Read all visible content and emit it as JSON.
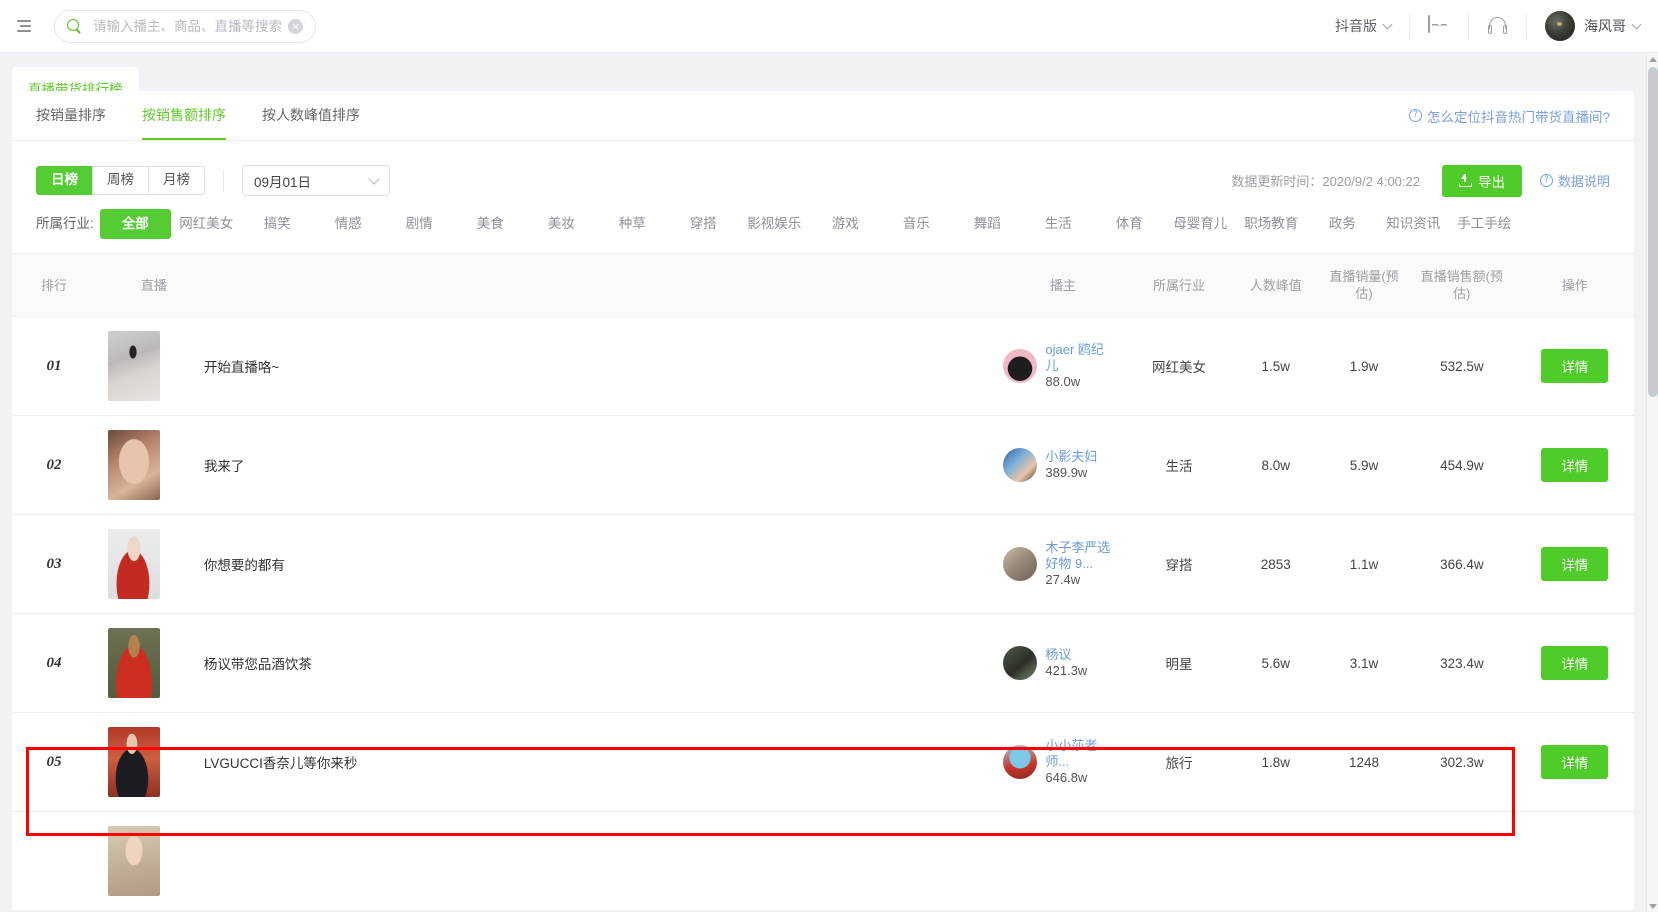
{
  "header": {
    "collapse_icon": "menu-collapse-icon",
    "search": {
      "placeholder": "请输入播主、商品、直播等搜索",
      "value": "",
      "icon": "search-icon",
      "clear": "×"
    },
    "version_label": "抖音版",
    "monitor_icon": "monitor-chart-icon",
    "service_icon": "headset-icon",
    "username": "海风哥"
  },
  "page_tab": {
    "label": "直播带货排行榜"
  },
  "sort_tabs": [
    {
      "label": "按销量排序",
      "active": false
    },
    {
      "label": "按销售额排序",
      "active": true
    },
    {
      "label": "按人数峰值排序",
      "active": false
    }
  ],
  "help_link": {
    "icon": "question-circle-icon",
    "label": "怎么定位抖音热门带货直播间?"
  },
  "period": {
    "options": [
      {
        "label": "日榜",
        "active": true
      },
      {
        "label": "周榜",
        "active": false
      },
      {
        "label": "月榜",
        "active": false
      }
    ],
    "date_value": "09月01日",
    "date_chevron": "chevron-down-icon"
  },
  "toolbar": {
    "update_time": "数据更新时间：2020/9/2 4:00:22",
    "export_label": "导出",
    "export_icon": "upload-icon",
    "data_desc_label": "数据说明",
    "data_desc_icon": "question-circle-icon"
  },
  "industry": {
    "label": "所属行业:",
    "items": [
      {
        "label": "全部",
        "active": true
      },
      {
        "label": "网红美女",
        "active": false
      },
      {
        "label": "搞笑",
        "active": false
      },
      {
        "label": "情感",
        "active": false
      },
      {
        "label": "剧情",
        "active": false
      },
      {
        "label": "美食",
        "active": false
      },
      {
        "label": "美妆",
        "active": false
      },
      {
        "label": "种草",
        "active": false
      },
      {
        "label": "穿搭",
        "active": false
      },
      {
        "label": "影视娱乐",
        "active": false
      },
      {
        "label": "游戏",
        "active": false
      },
      {
        "label": "音乐",
        "active": false
      },
      {
        "label": "舞蹈",
        "active": false
      },
      {
        "label": "生活",
        "active": false
      },
      {
        "label": "体育",
        "active": false
      },
      {
        "label": "母婴育儿",
        "active": false
      },
      {
        "label": "职场教育",
        "active": false
      },
      {
        "label": "政务",
        "active": false
      },
      {
        "label": "知识资讯",
        "active": false
      },
      {
        "label": "手工手绘",
        "active": false
      }
    ]
  },
  "table": {
    "columns": [
      "排行",
      "直播",
      "播主",
      "所属行业",
      "人数峰值",
      "直播销量(预估)",
      "直播销售额(预估)",
      "操作"
    ],
    "action_label": "详情",
    "rows": [
      {
        "rank": "01",
        "title": "开始直播咯~",
        "host_name": "ojaer 鸥纪儿",
        "host_fans": "88.0w",
        "industry": "网红美女",
        "peak": "1.5w",
        "sales": "1.9w",
        "amount": "532.5w",
        "highlighted": false
      },
      {
        "rank": "02",
        "title": "我来了",
        "host_name": "小影夫妇",
        "host_fans": "389.9w",
        "industry": "生活",
        "peak": "8.0w",
        "sales": "5.9w",
        "amount": "454.9w",
        "highlighted": false
      },
      {
        "rank": "03",
        "title": "你想要的都有",
        "host_name": "木子李严选好物 9...",
        "host_fans": "27.4w",
        "industry": "穿搭",
        "peak": "2853",
        "sales": "1.1w",
        "amount": "366.4w",
        "highlighted": false
      },
      {
        "rank": "04",
        "title": "杨议带您品酒饮茶",
        "host_name": "杨议",
        "host_fans": "421.3w",
        "industry": "明星",
        "peak": "5.6w",
        "sales": "3.1w",
        "amount": "323.4w",
        "highlighted": true
      },
      {
        "rank": "05",
        "title": "LVGUCCI香奈儿等你来秒",
        "host_name": "小小莎老师...",
        "host_fans": "646.8w",
        "industry": "旅行",
        "peak": "1.8w",
        "sales": "1248",
        "amount": "302.3w",
        "highlighted": false
      }
    ]
  },
  "colors": {
    "brand_green": "#55cc33",
    "link_blue": "#6b9ae0",
    "highlight_red": "#ff0000"
  }
}
